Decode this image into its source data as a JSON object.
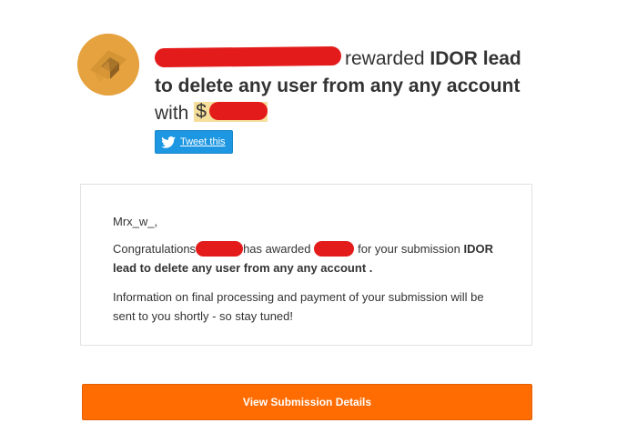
{
  "header": {
    "avatar_icon": "hexagon-logo-icon",
    "rewarded_text": "rewarded",
    "report_title_line1": "IDOR lead",
    "report_title_line2": "to delete any user from any any account",
    "with_text": "with",
    "amount_prefix": "$"
  },
  "tweet": {
    "icon": "twitter-bird-icon",
    "label": "Tweet this",
    "color": "#1e97e2"
  },
  "message": {
    "greeting": "Mrx_w_,",
    "congrats_prefix": "Congratulations",
    "has_awarded": "has awarded",
    "for_submission": "for your submission",
    "submission_title": "IDOR lead to delete any user from any any account .",
    "info": "Information on final processing and payment of your submission will be sent to you shortly - so stay tuned!"
  },
  "cta": {
    "label": "View Submission Details",
    "color": "#ff6c02"
  },
  "colors": {
    "redaction": "#e31b1b",
    "amount_highlight": "#f6df9b",
    "avatar": "#e6a23e"
  }
}
